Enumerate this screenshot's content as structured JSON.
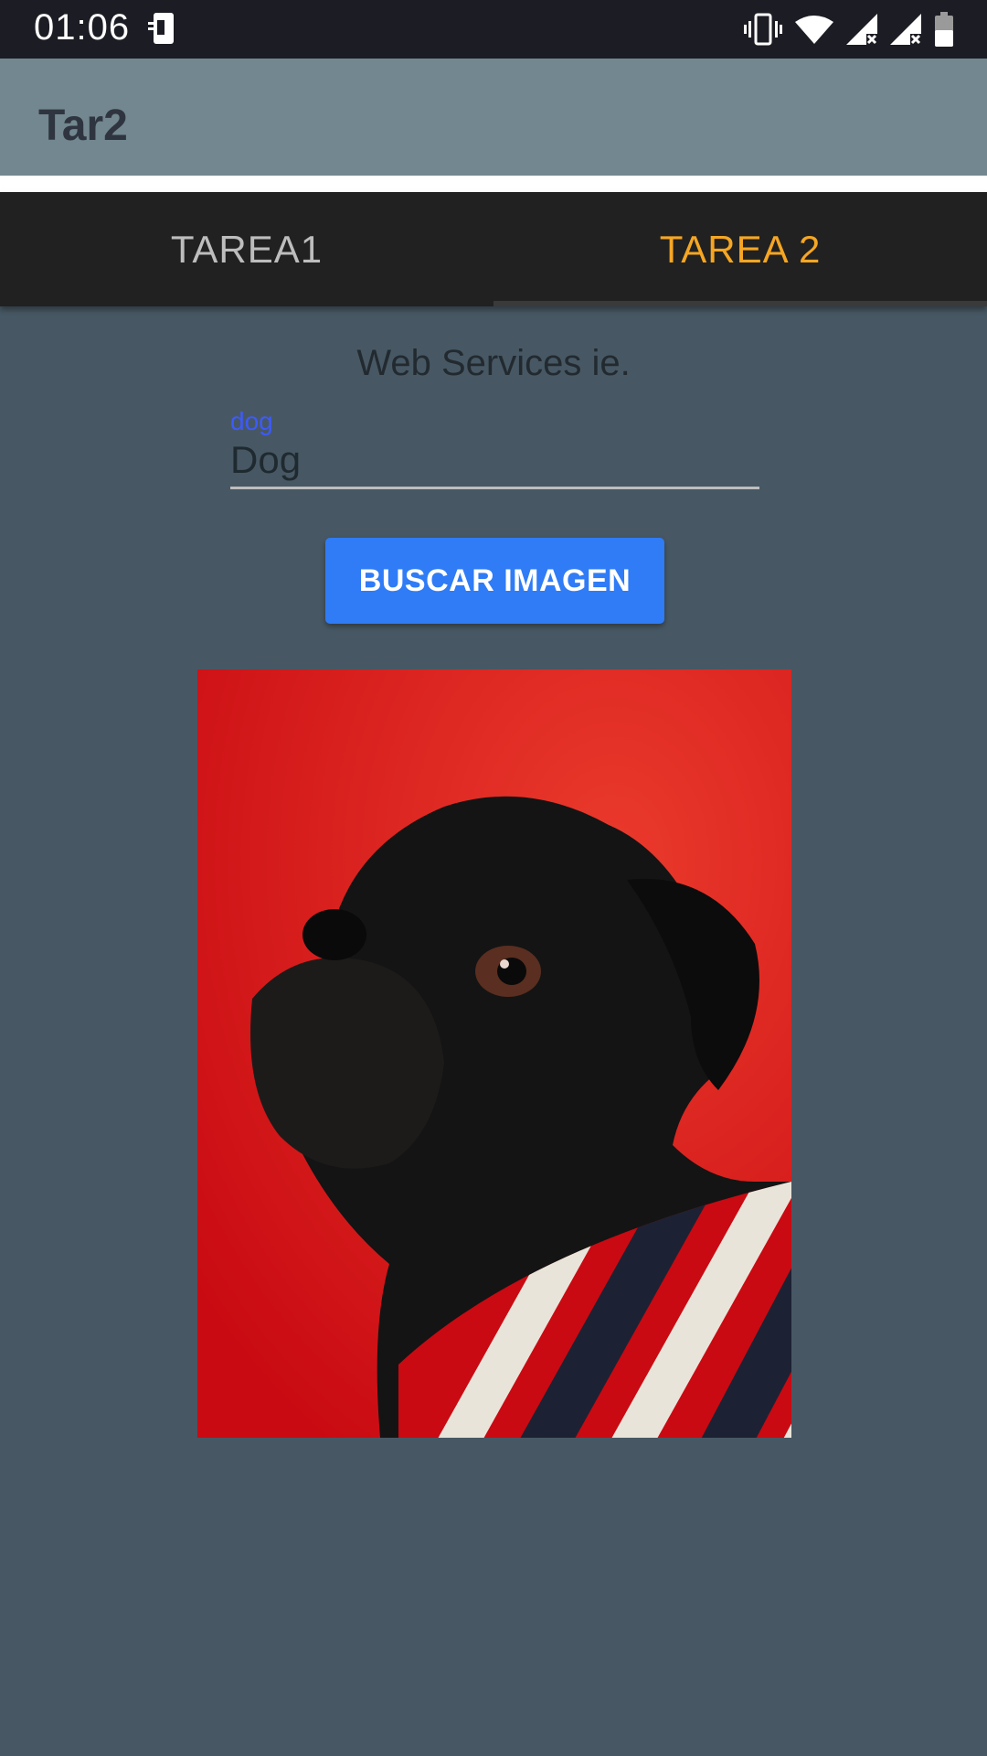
{
  "status_bar": {
    "time": "01:06"
  },
  "app_bar": {
    "title": "Tar2"
  },
  "tabs": [
    {
      "label": "TAREA1",
      "selected": false
    },
    {
      "label": "TAREA 2",
      "selected": true
    }
  ],
  "main": {
    "heading": "Web Services ie.",
    "search_field": {
      "floating_label": "dog",
      "value": "Dog"
    },
    "search_button_label": "BUSCAR IMAGEN"
  },
  "colors": {
    "accent_tab": "#f5a623",
    "button": "#2f7cf6",
    "label": "#3d5afe",
    "app_bar": "#72878f",
    "background": "#475864"
  },
  "icons": [
    "phone-screen-icon",
    "vibrate-icon",
    "wifi-icon",
    "signal-icon",
    "signal-icon",
    "battery-icon"
  ]
}
